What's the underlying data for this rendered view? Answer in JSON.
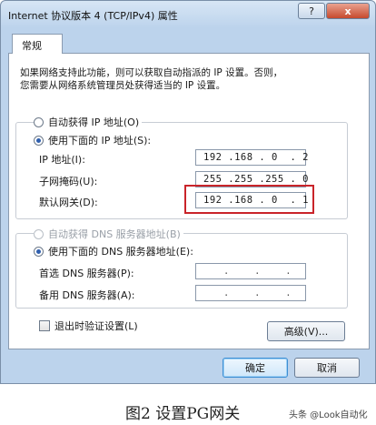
{
  "window": {
    "title": "Internet 协议版本 4 (TCP/IPv4) 属性",
    "help_label": "?",
    "close_label": "x"
  },
  "tab": {
    "label": "常规"
  },
  "description": {
    "line1": "如果网络支持此功能，则可以获取自动指派的 IP 设置。否则，",
    "line2": "您需要从网络系统管理员处获得适当的 IP 设置。"
  },
  "ip_section": {
    "auto_label": "自动获得 IP 地址(O)",
    "auto_selected": false,
    "manual_label": "使用下面的 IP 地址(S):",
    "manual_selected": true,
    "ip_label": "IP 地址(I):",
    "ip_value": "192 .168 . 0  . 2",
    "subnet_label": "子网掩码(U):",
    "subnet_value": "255 .255 .255 . 0",
    "gateway_label": "默认网关(D):",
    "gateway_value": "192 .168 . 0  . 1"
  },
  "dns_section": {
    "auto_label": "自动获得 DNS 服务器地址(B)",
    "auto_selected": false,
    "auto_disabled": true,
    "manual_label": "使用下面的 DNS 服务器地址(E):",
    "manual_selected": true,
    "preferred_label": "首选 DNS 服务器(P):",
    "preferred_value": ".    .    .",
    "alternate_label": "备用 DNS 服务器(A):",
    "alternate_value": ".    .    ."
  },
  "validate_label": "退出时验证设置(L)",
  "validate_checked": false,
  "buttons": {
    "advanced": "高级(V)...",
    "ok": "确定",
    "cancel": "取消"
  },
  "caption": "图2 设置PG网关",
  "watermark": "头条 @Look自动化",
  "colors": {
    "highlight_border": "#c9242a",
    "radio_dot": "#2f5fae"
  }
}
